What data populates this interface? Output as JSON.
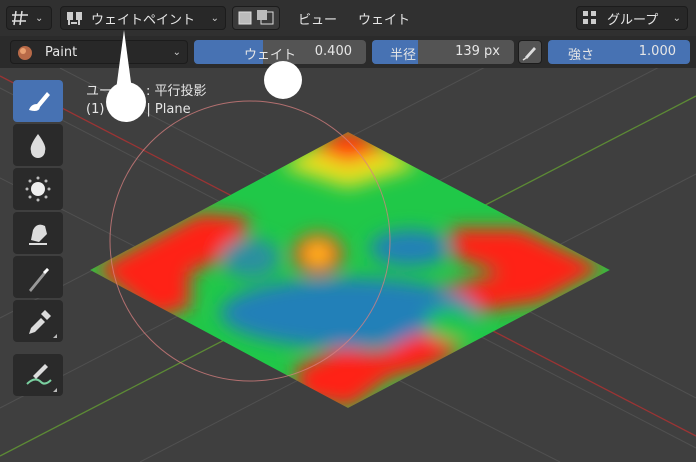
{
  "header": {
    "mode_label": "ウェイトペイント",
    "menu_view": "ビュー",
    "menu_weight": "ウェイト",
    "group_label": "グループ"
  },
  "toolbar": {
    "brush_name": "Paint",
    "weight": {
      "label": "ウェイト",
      "value": "0.400",
      "fraction": 0.4
    },
    "radius": {
      "label": "半径",
      "value": "139 px"
    },
    "strength": {
      "label": "強さ",
      "value": "1.000"
    }
  },
  "viewport": {
    "view_label_1": "ユー",
    "view_label_2": ": 平行投影",
    "object_label_1": "(1)",
    "object_label_2": "| Plane"
  },
  "tools": [
    {
      "name": "draw-brush-tool",
      "active": true
    },
    {
      "name": "blur-tool",
      "active": false
    },
    {
      "name": "average-tool",
      "active": false
    },
    {
      "name": "smear-tool",
      "active": false
    },
    {
      "name": "gradient-tool",
      "active": false
    },
    {
      "name": "sample-weight-tool",
      "active": false
    },
    {
      "name": "annotate-tool",
      "active": false
    }
  ],
  "colors": {
    "accent": "#4772b3",
    "header_bg": "#303030",
    "viewport_bg": "#3f3f3f",
    "weight_red": "#ff2020",
    "weight_yellow": "#e8e820",
    "weight_green": "#20d040",
    "weight_blue": "#2080b0"
  }
}
